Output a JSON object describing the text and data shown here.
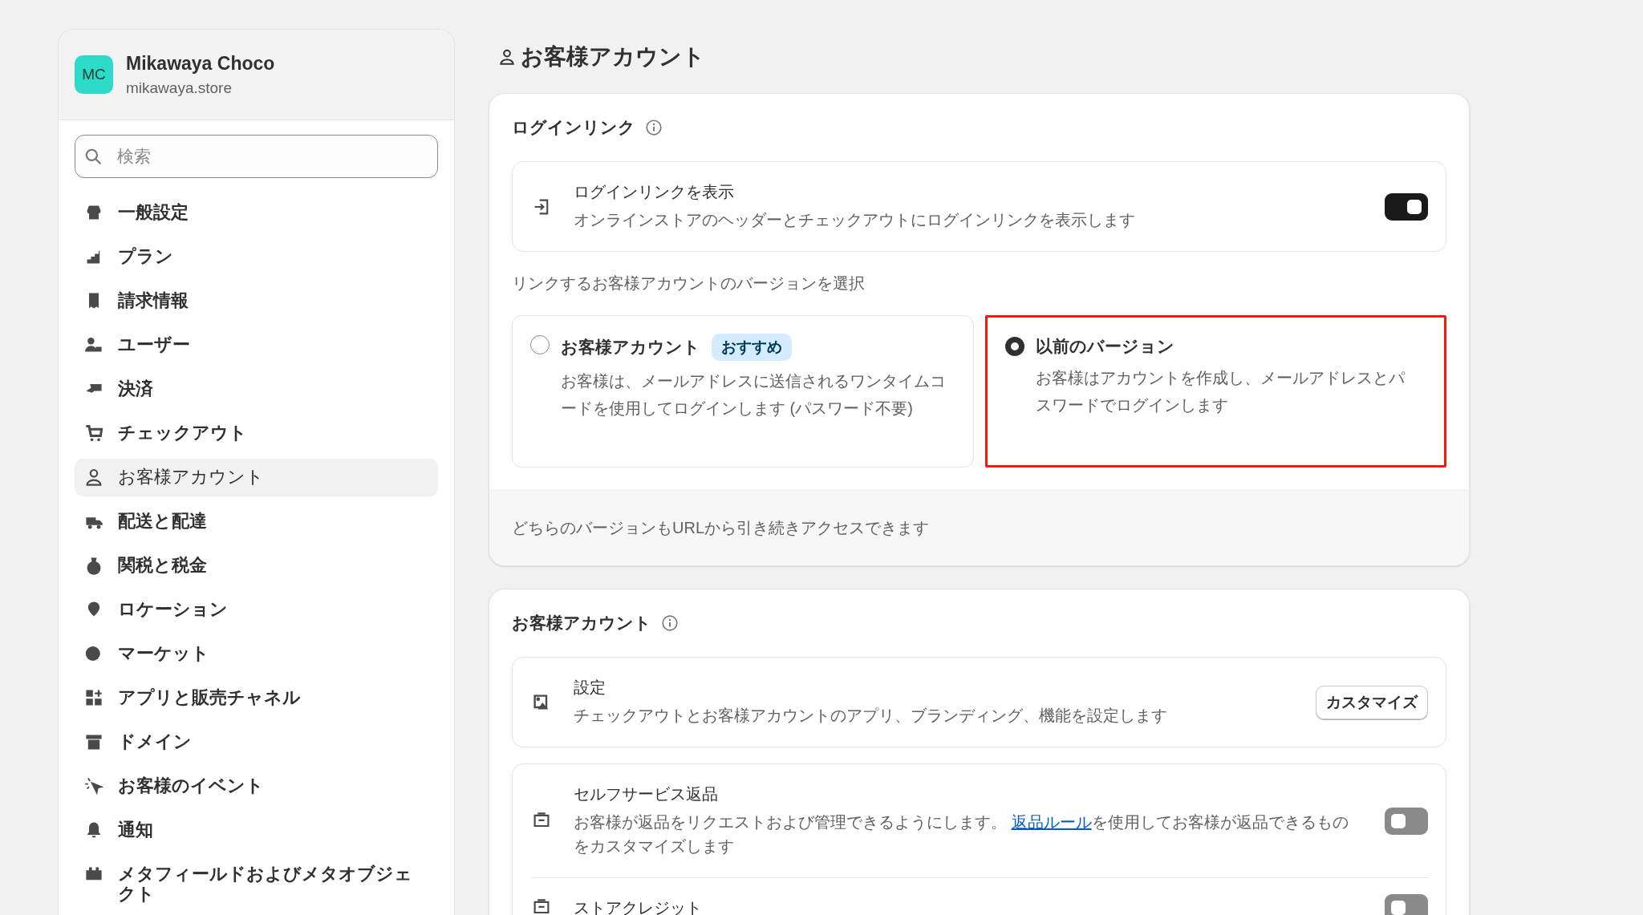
{
  "store": {
    "initials": "MC",
    "name": "Mikawaya Choco",
    "domain": "mikawaya.store"
  },
  "search": {
    "placeholder": "検索"
  },
  "nav": [
    {
      "label": "一般設定",
      "selected": false
    },
    {
      "label": "プラン",
      "selected": false
    },
    {
      "label": "請求情報",
      "selected": false
    },
    {
      "label": "ユーザー",
      "selected": false
    },
    {
      "label": "決済",
      "selected": false
    },
    {
      "label": "チェックアウト",
      "selected": false
    },
    {
      "label": "お客様アカウント",
      "selected": true
    },
    {
      "label": "配送と配達",
      "selected": false
    },
    {
      "label": "関税と税金",
      "selected": false
    },
    {
      "label": "ロケーション",
      "selected": false
    },
    {
      "label": "マーケット",
      "selected": false
    },
    {
      "label": "アプリと販売チャネル",
      "selected": false
    },
    {
      "label": "ドメイン",
      "selected": false
    },
    {
      "label": "お客様のイベント",
      "selected": false
    },
    {
      "label": "通知",
      "selected": false
    },
    {
      "label": "メタフィールドおよびメタオブジェクト",
      "selected": false
    }
  ],
  "page_title": "お客様アカウント",
  "login_card": {
    "title": "ログインリンク",
    "toggle_row": {
      "title": "ログインリンクを表示",
      "description": "オンラインストアのヘッダーとチェックアウトにログインリンクを表示します",
      "on": true
    },
    "version_prompt": "リンクするお客様アカウントのバージョンを選択",
    "options": [
      {
        "title": "お客様アカウント",
        "badge": "おすすめ",
        "description": "お客様は、メールアドレスに送信されるワンタイムコードを使用してログインします (パスワード不要)",
        "selected": false,
        "highlighted": false
      },
      {
        "title": "以前のバージョン",
        "description": "お客様はアカウントを作成し、メールアドレスとパスワードでログインします",
        "selected": true,
        "highlighted": true
      }
    ],
    "footer": "どちらのバージョンもURLから引き続きアクセスできます"
  },
  "accounts_card": {
    "title": "お客様アカウント",
    "rows": [
      {
        "kind": "button",
        "title": "設定",
        "description": "チェックアウトとお客様アカウントのアプリ、ブランディング、機能を設定します",
        "button": "カスタマイズ"
      },
      {
        "kind": "toggle",
        "title": "セルフサービス返品",
        "description_before": "お客様が返品をリクエストおよび管理できるようにします。 ",
        "link": "返品ルール",
        "description_after": "を使用してお客様が返品できるものをカスタマイズします",
        "on": false
      },
      {
        "kind": "toggle",
        "title": "ストアクレジット",
        "on": false
      }
    ]
  }
}
